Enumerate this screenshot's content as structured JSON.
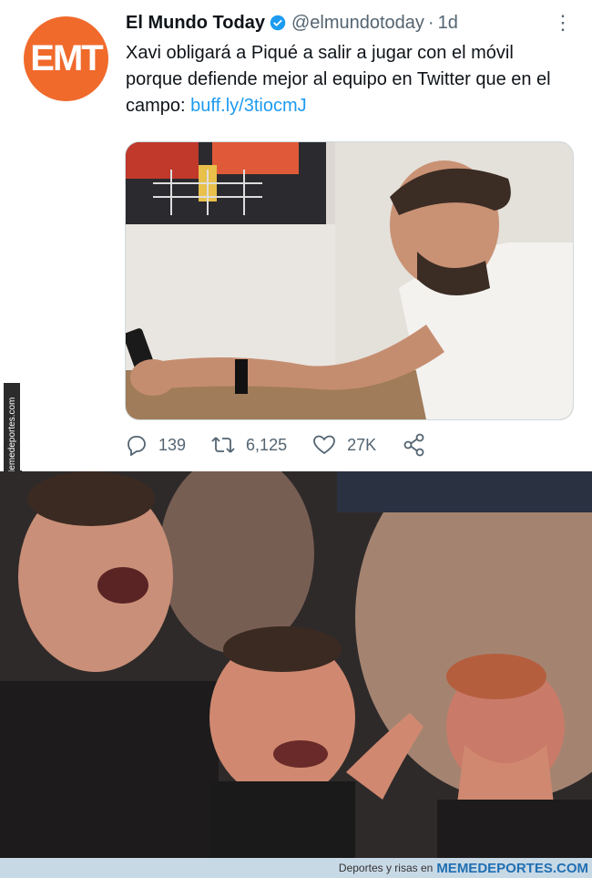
{
  "watermark_side": "Memedeportes.com",
  "tweet": {
    "avatar_text": "EMT",
    "display_name": "El Mundo Today",
    "handle": "@elmundotoday",
    "separator": "·",
    "time": "1d",
    "text_main": "Xavi obligará a Piqué a salir a jugar con el móvil porque defiende mejor al equipo en Twitter que en el campo: ",
    "link": "buff.ly/3tiocmJ",
    "stats": {
      "replies": "139",
      "retweets": "6,125",
      "likes": "27K"
    },
    "colors": {
      "brand": "#f06a2c",
      "link": "#1d9bf0",
      "verified": "#1d9bf0"
    }
  },
  "footer": {
    "prefix": "Deportes y risas en",
    "brand": "MEMEDEPORTES.COM"
  }
}
